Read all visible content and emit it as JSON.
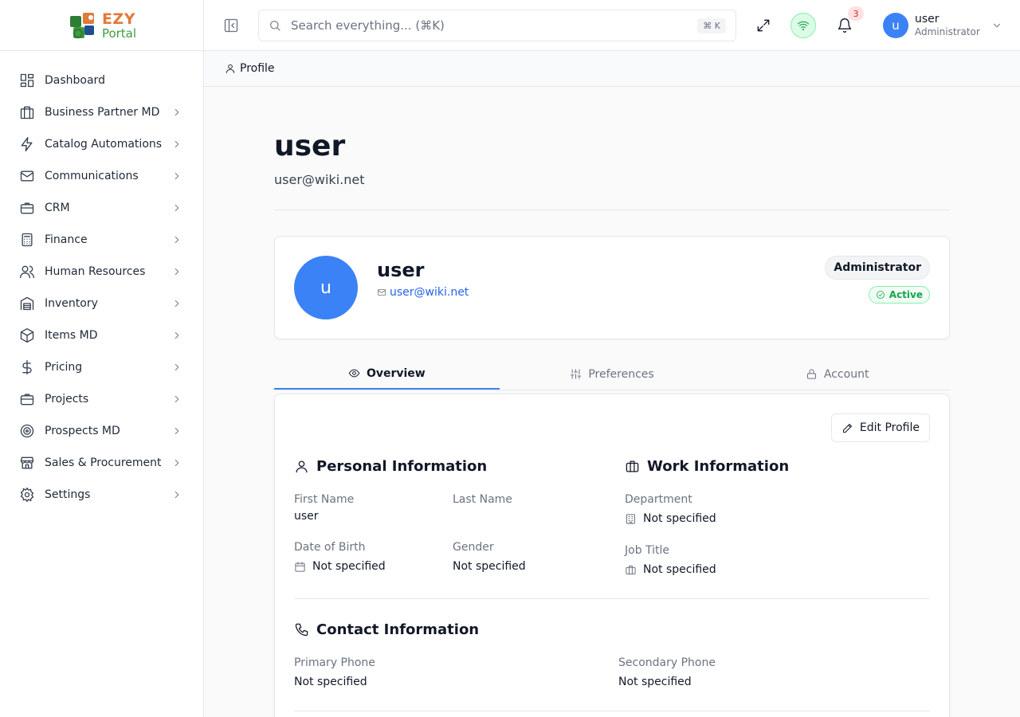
{
  "brand": {
    "name_top": "EZY",
    "name_bottom": "Portal"
  },
  "sidebar": {
    "items": [
      {
        "label": "Dashboard",
        "icon": "dashboard-icon"
      },
      {
        "label": "Business Partner MD",
        "icon": "building-icon"
      },
      {
        "label": "Catalog Automations",
        "icon": "lightning-icon"
      },
      {
        "label": "Communications",
        "icon": "mail-icon"
      },
      {
        "label": "CRM",
        "icon": "briefcase-icon"
      },
      {
        "label": "Finance",
        "icon": "calculator-icon"
      },
      {
        "label": "Human Resources",
        "icon": "users-icon"
      },
      {
        "label": "Inventory",
        "icon": "warehouse-icon"
      },
      {
        "label": "Items MD",
        "icon": "box-icon"
      },
      {
        "label": "Pricing",
        "icon": "dollar-icon"
      },
      {
        "label": "Projects",
        "icon": "briefcase-icon"
      },
      {
        "label": "Prospects MD",
        "icon": "target-icon"
      },
      {
        "label": "Sales & Procurement",
        "icon": "store-icon"
      },
      {
        "label": "Settings",
        "icon": "gear-icon"
      }
    ]
  },
  "topbar": {
    "search_placeholder": "Search everything... (⌘K)",
    "search_shortcut": "⌘ K",
    "notification_count": "3",
    "user_initial": "u",
    "user_name": "user",
    "user_role": "Administrator"
  },
  "breadcrumb": {
    "label": "Profile"
  },
  "page": {
    "title": "user",
    "subtitle": "user@wiki.net"
  },
  "profile_card": {
    "initial": "u",
    "name": "user",
    "email": "user@wiki.net",
    "role": "Administrator",
    "status": "Active"
  },
  "tabs": [
    {
      "label": "Overview",
      "icon": "eye-icon",
      "active": true
    },
    {
      "label": "Preferences",
      "icon": "sliders-icon",
      "active": false
    },
    {
      "label": "Account",
      "icon": "lock-icon",
      "active": false
    }
  ],
  "overview": {
    "edit_label": "Edit Profile",
    "personal": {
      "heading": "Personal Information",
      "first_name_label": "First Name",
      "first_name": "user",
      "last_name_label": "Last Name",
      "last_name": "",
      "dob_label": "Date of Birth",
      "dob": "Not specified",
      "gender_label": "Gender",
      "gender": "Not specified"
    },
    "work": {
      "heading": "Work Information",
      "department_label": "Department",
      "department": "Not specified",
      "job_title_label": "Job Title",
      "job_title": "Not specified"
    },
    "contact": {
      "heading": "Contact Information",
      "primary_label": "Primary Phone",
      "primary": "Not specified",
      "secondary_label": "Secondary Phone",
      "secondary": "Not specified"
    }
  },
  "colors": {
    "accent": "#3b82f6",
    "link": "#2563eb",
    "success": "#16a34a",
    "danger": "#dc2626"
  }
}
